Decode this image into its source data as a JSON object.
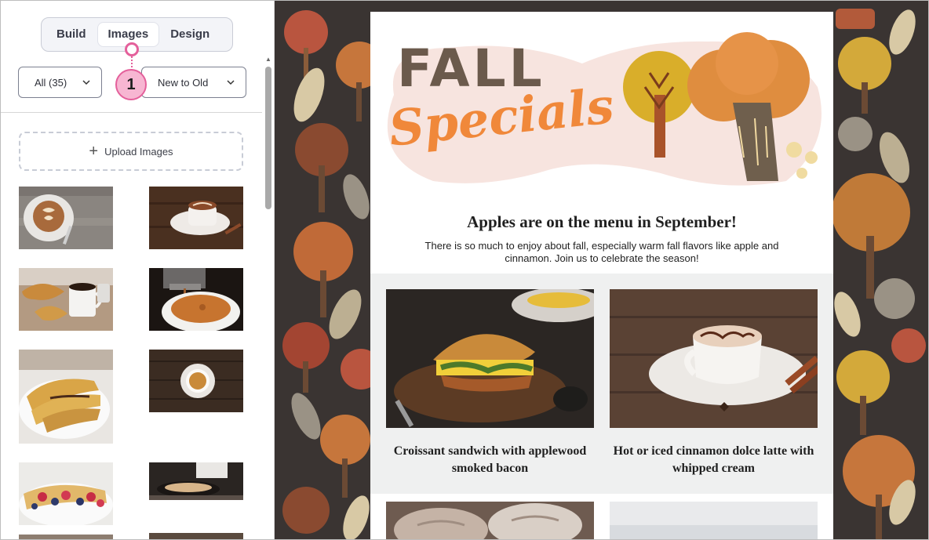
{
  "panel": {
    "tabs": [
      {
        "label": "Build",
        "active": false
      },
      {
        "label": "Images",
        "active": true
      },
      {
        "label": "Design",
        "active": false
      }
    ],
    "filter_label": "All (35)",
    "sort_label": "New to Old",
    "callout_number": "1",
    "upload_label": "Upload Images",
    "thumbnails": [
      "latte-art-icon",
      "hot-chocolate-icon",
      "croissant-coffee-icon",
      "espresso-pour-icon",
      "crepes-icon",
      "tea-cup-icon",
      "berry-crepes-icon",
      "chef-cooking-icon"
    ]
  },
  "email": {
    "hero": {
      "title_line1": "FALL",
      "title_line2": "Specials"
    },
    "heading": "Apples are on the menu in September!",
    "body": "There is so much to enjoy about fall, especially warm fall flavors like apple and cinnamon. Join us to celebrate the season!",
    "products": [
      {
        "caption": "Croissant sandwich with applewood smoked bacon"
      },
      {
        "caption": "Hot or iced cinnamon dolce latte with whipped cream"
      }
    ]
  },
  "colors": {
    "accent_pink": "#e4609b",
    "hero_orange": "#f0883a",
    "hero_brown": "#6b5a4c",
    "pattern_bg": "#3a3432"
  }
}
